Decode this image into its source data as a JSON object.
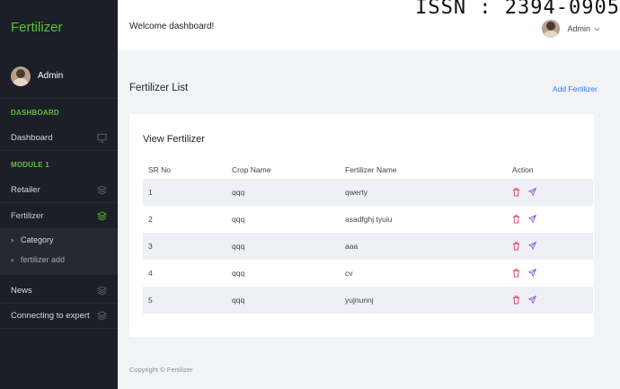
{
  "brand": "Fertilizer",
  "sidebar": {
    "user_name": "Admin",
    "sections": {
      "dashboard": "DASHBOARD",
      "module1": "MODULE 1"
    },
    "items": {
      "dashboard": "Dashboard",
      "retailer": "Retailer",
      "fertilizer": "Fertilizer",
      "category": "Category",
      "fertilizer_add": "fertilizer add",
      "news": "News",
      "expert": "Connecting to expert"
    }
  },
  "header": {
    "welcome": "Welcome dashboard!",
    "overlay_text": "ISSN : 2394-0905",
    "user_name": "Admin"
  },
  "page": {
    "title": "Fertilizer List",
    "add_link": "Add Fertilizer"
  },
  "card": {
    "title": "View Fertilizer",
    "columns": [
      "SR No",
      "Crop Name",
      "Fertilizer Name",
      "Action"
    ],
    "rows": [
      {
        "sr": "1",
        "crop": "qqq",
        "fertilizer": "qwerty"
      },
      {
        "sr": "2",
        "crop": "qqq",
        "fertilizer": "asadfghj tyuiu"
      },
      {
        "sr": "3",
        "crop": "qqq",
        "fertilizer": "aaa"
      },
      {
        "sr": "4",
        "crop": "qqq",
        "fertilizer": "cv"
      },
      {
        "sr": "5",
        "crop": "qqq",
        "fertilizer": "yujnunnj"
      }
    ]
  },
  "footer": "Copyright © Fertilizer",
  "colors": {
    "sidebar_bg": "#1c1f28",
    "brand_green": "#5fbf3a",
    "link_blue": "#2f7ae5",
    "delete_red": "#e0385c",
    "edit_purple": "#8f4fd8",
    "stripe": "#eef0f6"
  },
  "icons": {
    "dashboard": "monitor-icon",
    "modules": "layers-icon",
    "delete": "trash-icon",
    "edit": "send-icon",
    "dropdown": "chevron-down-icon",
    "submenu": "chevron-right-icon"
  }
}
